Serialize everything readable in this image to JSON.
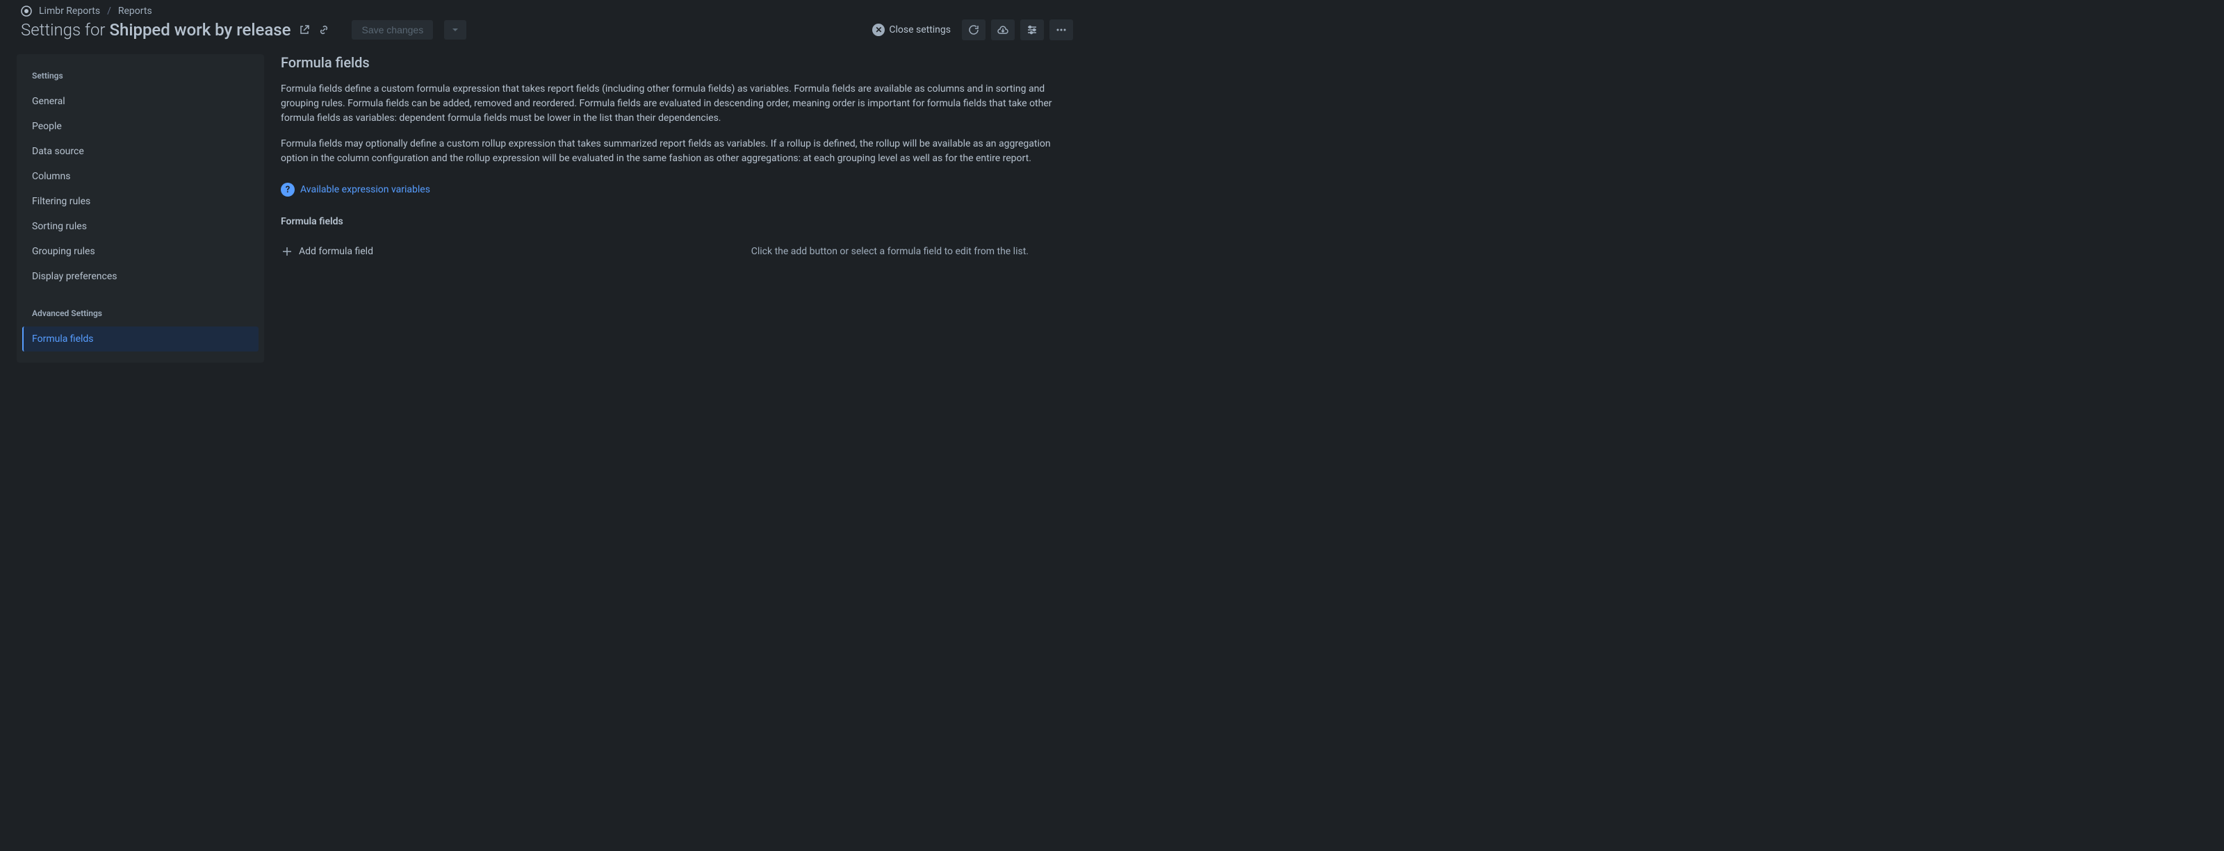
{
  "breadcrumb": {
    "root": "Limbr Reports",
    "current": "Reports"
  },
  "page": {
    "title_prefix": "Settings for",
    "title_main": "Shipped work by release"
  },
  "toolbar": {
    "save_label": "Save changes",
    "close_label": "Close settings"
  },
  "sidebar": {
    "sections": [
      {
        "title": "Settings",
        "items": [
          {
            "label": "General",
            "active": false
          },
          {
            "label": "People",
            "active": false
          },
          {
            "label": "Data source",
            "active": false
          },
          {
            "label": "Columns",
            "active": false
          },
          {
            "label": "Filtering rules",
            "active": false
          },
          {
            "label": "Sorting rules",
            "active": false
          },
          {
            "label": "Grouping rules",
            "active": false
          },
          {
            "label": "Display preferences",
            "active": false
          }
        ]
      },
      {
        "title": "Advanced Settings",
        "items": [
          {
            "label": "Formula fields",
            "active": true
          }
        ]
      }
    ]
  },
  "content": {
    "heading": "Formula fields",
    "paragraph1": "Formula fields define a custom formula expression that takes report fields (including other formula fields) as variables. Formula fields are available as columns and in sorting and grouping rules. Formula fields can be added, removed and reordered. Formula fields are evaluated in descending order, meaning order is important for formula fields that take other formula fields as variables: dependent formula fields must be lower in the list than their dependencies.",
    "paragraph2": "Formula fields may optionally define a custom rollup expression that takes summarized report fields as variables. If a rollup is defined, the rollup will be available as an aggregation option in the column configuration and the rollup expression will be evaluated in the same fashion as other aggregations: at each grouping level as well as for the entire report.",
    "variables_link": "Available expression variables",
    "section_label": "Formula fields",
    "add_button": "Add formula field",
    "empty_hint": "Click the add button or select a formula field to edit from the list."
  }
}
